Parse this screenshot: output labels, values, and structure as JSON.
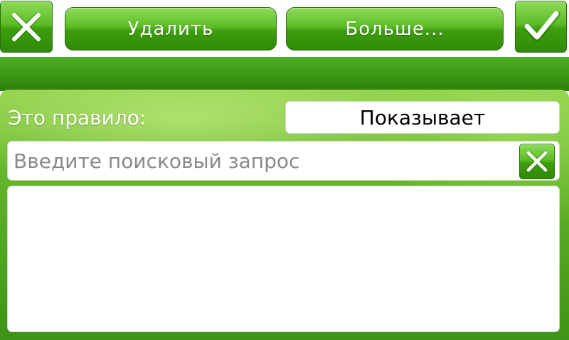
{
  "toolbar": {
    "close_icon": "close-x-icon",
    "delete_label": "Удалить",
    "more_label": "Больше...",
    "ok_icon": "checkmark-icon"
  },
  "rule": {
    "label": "Это правило:",
    "value": "Показывает"
  },
  "search": {
    "value": "",
    "placeholder": "Введите поисковый запрос",
    "clear_icon": "close-x-icon"
  },
  "results": {
    "items": []
  },
  "colors": {
    "accent_green": "#3e9d0f",
    "button_border": "#2a6f0e",
    "label_text": "#ffffff",
    "placeholder_text": "#8a8a8a"
  }
}
